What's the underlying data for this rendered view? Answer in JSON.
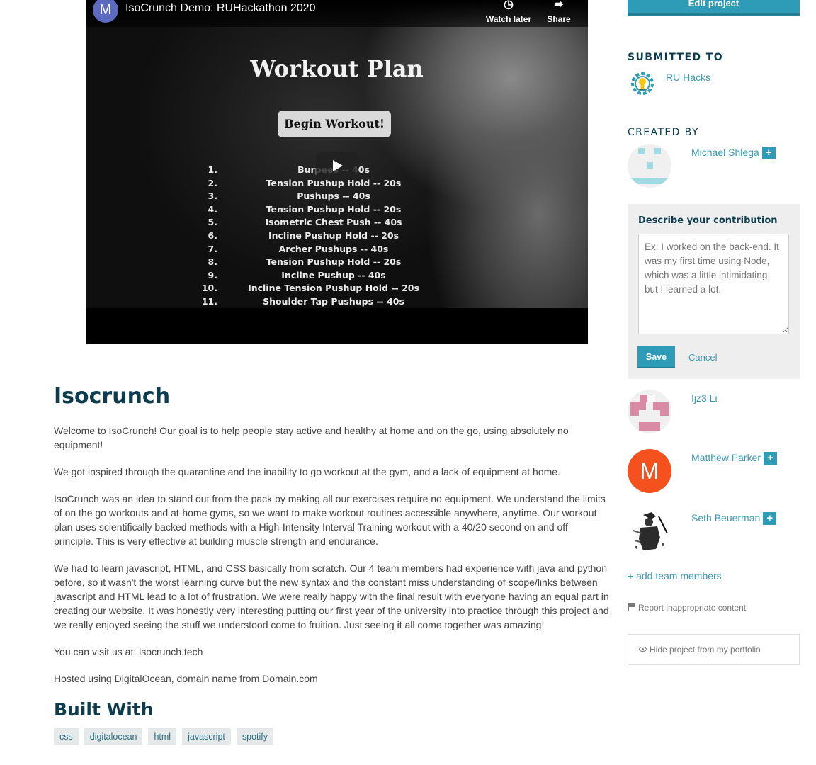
{
  "video": {
    "channel_initial": "M",
    "title": "IsoCrunch Demo: RUHackathon 2020",
    "watch_later_label": "Watch later",
    "share_label": "Share",
    "slide_title": "Workout Plan",
    "begin_button": "Begin Workout!",
    "plan": [
      {
        "num": "1.",
        "text": "Burpees -- 40s"
      },
      {
        "num": "2.",
        "text": "Tension Pushup Hold -- 20s"
      },
      {
        "num": "3.",
        "text": "Pushups -- 40s"
      },
      {
        "num": "4.",
        "text": "Tension Pushup Hold -- 20s"
      },
      {
        "num": "5.",
        "text": "Isometric Chest Push -- 40s"
      },
      {
        "num": "6.",
        "text": "Incline Pushup Hold -- 20s"
      },
      {
        "num": "7.",
        "text": "Archer Pushups -- 40s"
      },
      {
        "num": "8.",
        "text": "Tension Pushup Hold -- 20s"
      },
      {
        "num": "9.",
        "text": "Incline Pushup -- 40s"
      },
      {
        "num": "10.",
        "text": "Incline Tension Pushup Hold -- 20s"
      },
      {
        "num": "11.",
        "text": "Shoulder Tap Pushups -- 40s"
      }
    ]
  },
  "project": {
    "title": "Isocrunch",
    "paragraphs": [
      "Welcome to IsoCrunch! Our goal is to help people stay active and healthy at home and on the go, using absolutely no equipment!",
      "We got inspired through the quarantine and the inability to go workout at the gym, and a lack of equipment at home.",
      "IsoCrunch was an idea to stand out from the pack by making all our exercises require no equipment. We understand the limits of on the go workouts and at-home gyms, so we want to make workout routines accessible anywhere, anytime. Our workout plan uses scientifically backed methods with a High-Intensity Interval Training workout with a 40/20 second on and off principle. This is very effective at building muscle strength and endurance.",
      "We had to learn javascript, HTML, and CSS basically from scratch. Our 4 team members had experience with java and python before, so it wasn't the worst learning curve but the new syntax and the constant miss understanding of scope/links between javascript and HTML lead to a lot of frustration. We were really happy with the final result with everyone having an equal part in creating our website. It was honestly very interesting putting our first year of the university into practice through this project and we really enjoyed seeing the stuff we understood come to fruition. Just seeing it all come together was amazing!",
      "You can visit us at: isocrunch.tech",
      "Hosted using DigitalOcean, domain name from Domain.com"
    ],
    "built_with_title": "Built With",
    "tags": [
      "css",
      "digitalocean",
      "html",
      "javascript",
      "spotify"
    ]
  },
  "sidebar": {
    "edit_button": "Edit project",
    "submitted_to_label": "SUBMITTED TO",
    "hackathon_name": "RU Hacks",
    "created_by_label": "CREATED BY",
    "members": [
      {
        "name": "Michael Shlega",
        "add": "+"
      },
      {
        "name": "Ijz3 Li"
      },
      {
        "name": "Matthew Parker",
        "add": "+",
        "initial": "M"
      },
      {
        "name": "Seth Beuerman",
        "add": "+"
      }
    ],
    "contribution": {
      "label": "Describe your contribution",
      "placeholder": "Ex: I worked on the back-end. It was my first time using Node, which was a little intimidating, but I learned a lot.",
      "save": "Save",
      "cancel": "Cancel"
    },
    "add_team_members": "+ add team members",
    "report": "Report inappropriate content",
    "hide": "Hide project from my portfolio"
  },
  "colors": {
    "accent": "#2e9cb6",
    "heading": "#0c3c4e",
    "link": "#3a9bb5",
    "avatar_orange": "#f4511e",
    "avatar_pink": "#d98aa4",
    "avatar_cyan": "#9fdbe4"
  }
}
